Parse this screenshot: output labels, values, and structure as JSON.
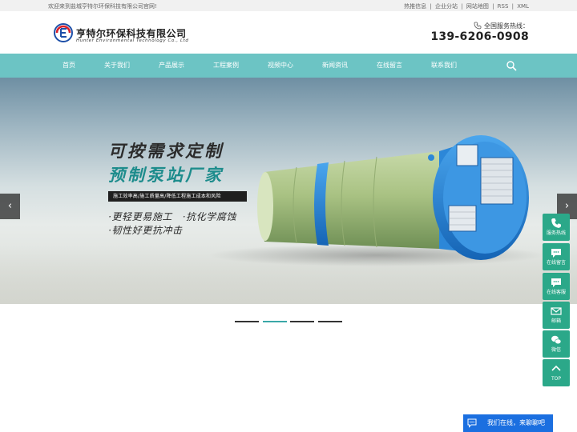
{
  "topbar": {
    "welcome": "欢迎来到盐城亨特尔环保科技有限公司官网!",
    "links": [
      "热推信息",
      "企业分站",
      "网站地图",
      "RSS",
      "XML"
    ],
    "separator": "|"
  },
  "header": {
    "company_cn": "亨特尔环保科技有限公司",
    "company_en": "Hunter Environmental Technology Co., Ltd",
    "hotline_label": "全国服务热线：",
    "hotline_number": "139-6206-0908"
  },
  "nav": {
    "items": [
      "首页",
      "关于我们",
      "产品展示",
      "工程案例",
      "视频中心",
      "新闻资讯",
      "在线留言",
      "联系我们"
    ],
    "search_icon": "search-icon"
  },
  "banner": {
    "headline1": "可按需求定制",
    "headline2": "预制泵站厂家",
    "tagline": "施工效率高/施工质量高/降低工程施工成本和风险",
    "bullet1": "·更轻更易施工　·抗化学腐蚀",
    "bullet2": "·韧性好更抗冲击",
    "prev_arrow": "‹",
    "next_arrow": "›",
    "slide_count": 4,
    "active_slide": 2
  },
  "float_bar": {
    "items": [
      {
        "label": "服务热线",
        "icon": "phone-icon"
      },
      {
        "label": "在线留言",
        "icon": "message-icon"
      },
      {
        "label": "在线客服",
        "icon": "chat-icon"
      },
      {
        "label": "邮箱",
        "icon": "mail-icon"
      },
      {
        "label": "微信",
        "icon": "wechat-icon"
      },
      {
        "label": "TOP",
        "icon": "arrow-up-icon"
      }
    ]
  },
  "chat": {
    "text": "我们在线，来聊聊吧"
  },
  "colors": {
    "nav_bg": "#6cc4c4",
    "accent": "#1d8c8c",
    "float_bg": "#2ba889",
    "chat_bg": "#1b6fe0"
  }
}
